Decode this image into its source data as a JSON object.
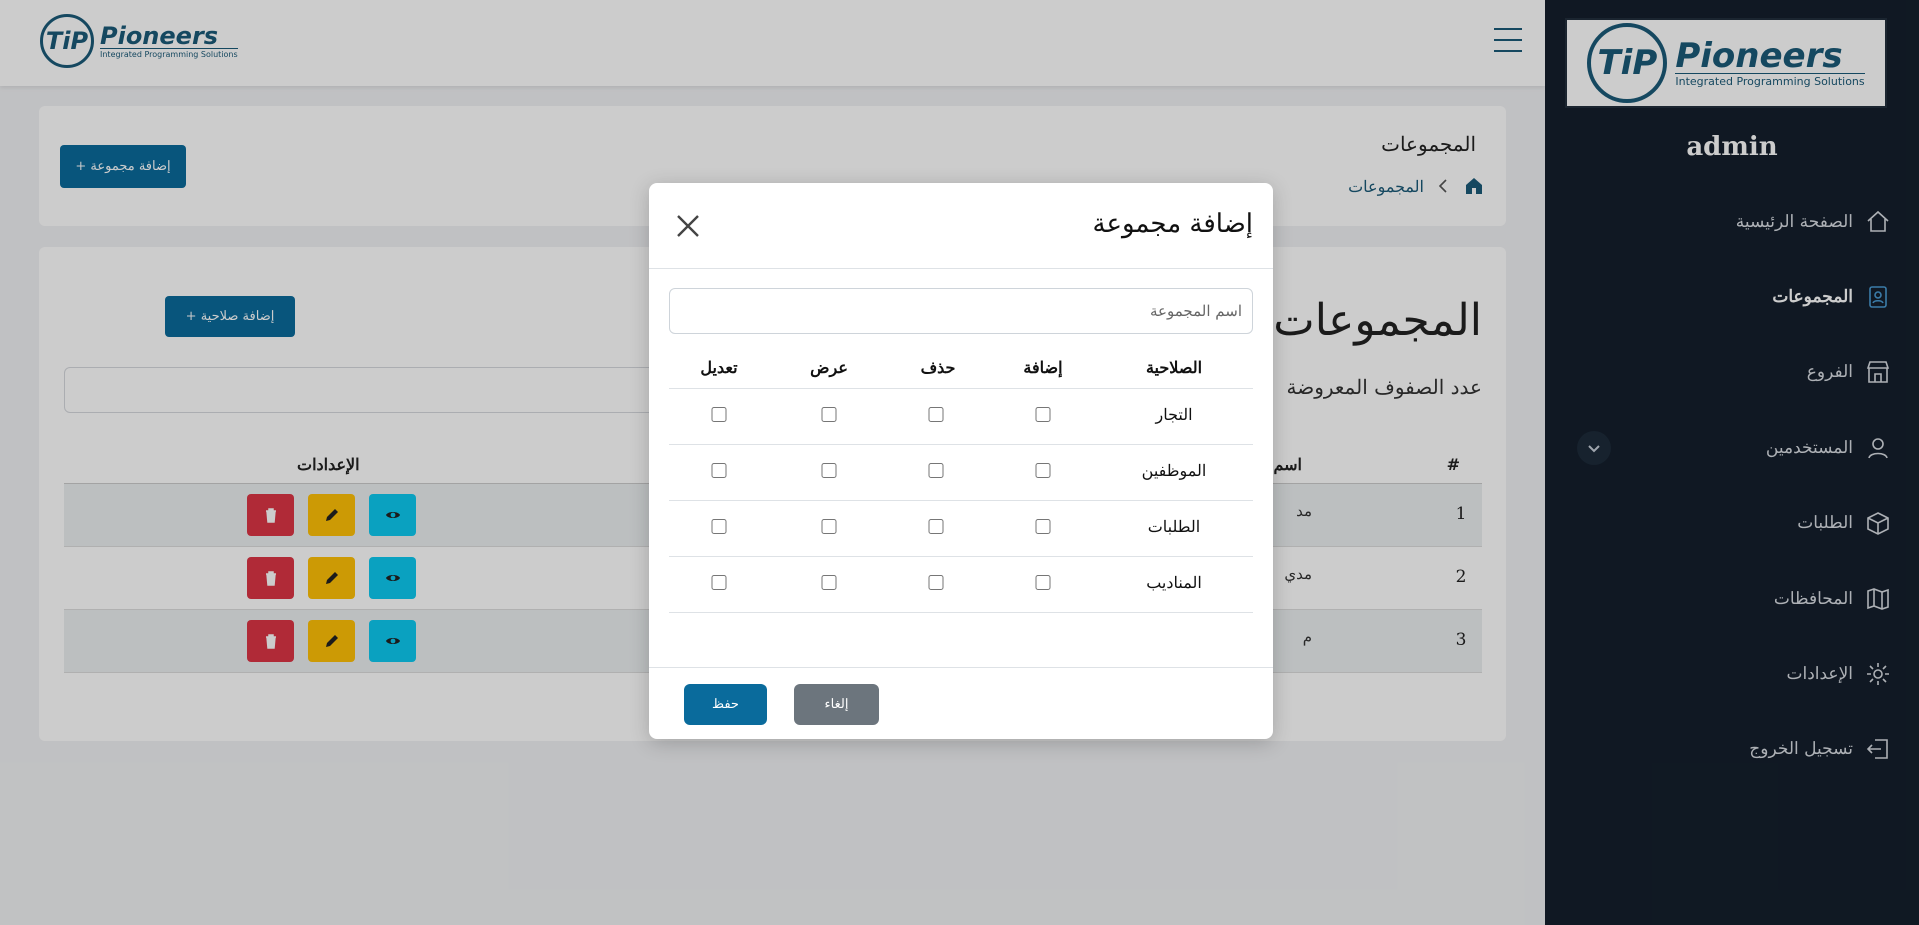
{
  "brand": {
    "name": "Pioneers",
    "tagline": "Integrated Programming Solutions",
    "logo_letters": "TiP"
  },
  "sidebar": {
    "user": "admin",
    "items": [
      {
        "label": "الصفحة الرئيسية",
        "icon": "home-icon"
      },
      {
        "label": "المجموعات",
        "icon": "user-badge-icon",
        "active": true
      },
      {
        "label": "الفروع",
        "icon": "store-icon"
      },
      {
        "label": "المستخدمين",
        "icon": "user-icon"
      },
      {
        "label": "الطلبات",
        "icon": "box-icon"
      },
      {
        "label": "المحافظات",
        "icon": "map-icon"
      },
      {
        "label": "الإعدادات",
        "icon": "gear-icon"
      },
      {
        "label": "تسجيل الخروج",
        "icon": "logout-icon"
      }
    ]
  },
  "header": {
    "page_title": "المجموعات",
    "breadcrumb": "المجموعات",
    "add_group_button": "+ إضافة مجموعة"
  },
  "main": {
    "title": "المجموعات",
    "add_permission_button": "+ إضافة صلاحية",
    "rows_label": "عدد الصفوف المعروضة",
    "columns": {
      "num": "#",
      "name": "اسم",
      "settings": "الإعدادات"
    },
    "rows": [
      {
        "num": "1",
        "name": "مد"
      },
      {
        "num": "2",
        "name": "مدي"
      },
      {
        "num": "3",
        "name": "م"
      }
    ]
  },
  "modal": {
    "title": "إضافة مجموعة",
    "name_placeholder": "اسم المجموعة",
    "headers": {
      "permission": "الصلاحية",
      "add": "إضافة",
      "delete": "حذف",
      "view": "عرض",
      "edit": "تعديل"
    },
    "rows": [
      "التجار",
      "الموظفين",
      "الطلبات",
      "المناديب"
    ],
    "save": "حفظ",
    "cancel": "إلغاء"
  },
  "colors": {
    "primary": "#0a6b9c",
    "sidebar": "#141f2c",
    "danger": "#dc3545",
    "warning": "#ffc107",
    "info": "#0dcaf0",
    "secondary": "#6c757d"
  }
}
